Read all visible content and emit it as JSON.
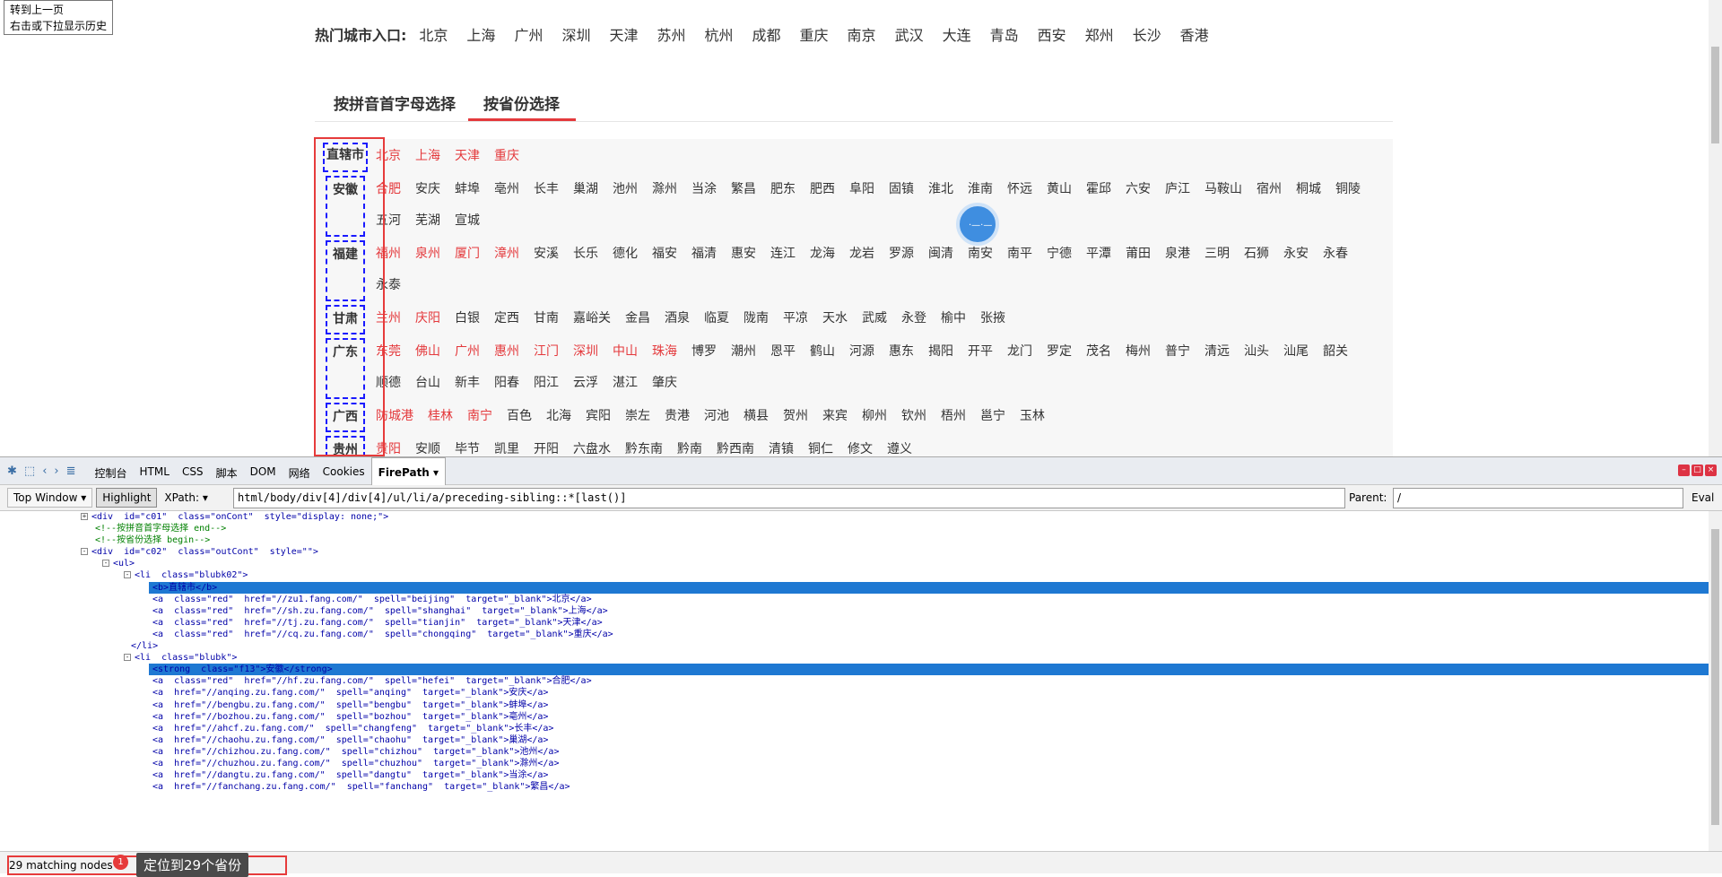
{
  "tooltip": {
    "line1": "转到上一页",
    "line2": "右击或下拉显示历史"
  },
  "hot": {
    "label": "热门城市入口:",
    "cities": [
      "北京",
      "上海",
      "广州",
      "深圳",
      "天津",
      "苏州",
      "杭州",
      "成都",
      "重庆",
      "南京",
      "武汉",
      "大连",
      "青岛",
      "西安",
      "郑州",
      "长沙",
      "香港"
    ]
  },
  "tabs": {
    "pinyin": "按拼音首字母选择",
    "province": "按省份选择"
  },
  "provinces": [
    {
      "name": "直辖市",
      "red": [
        "北京",
        "上海",
        "天津",
        "重庆"
      ],
      "cities": []
    },
    {
      "name": "安徽",
      "red": [
        "合肥"
      ],
      "cities": [
        "安庆",
        "蚌埠",
        "亳州",
        "长丰",
        "巢湖",
        "池州",
        "滁州",
        "当涂",
        "繁昌",
        "肥东",
        "肥西",
        "阜阳",
        "固镇",
        "淮北",
        "淮南",
        "怀远",
        "黄山",
        "霍邱",
        "六安",
        "庐江",
        "马鞍山",
        "宿州",
        "桐城",
        "铜陵",
        "五河",
        "芜湖",
        "宣城"
      ]
    },
    {
      "name": "福建",
      "red": [
        "福州",
        "泉州",
        "厦门",
        "漳州"
      ],
      "cities": [
        "安溪",
        "长乐",
        "德化",
        "福安",
        "福清",
        "惠安",
        "连江",
        "龙海",
        "龙岩",
        "罗源",
        "闽清",
        "南安",
        "南平",
        "宁德",
        "平潭",
        "莆田",
        "泉港",
        "三明",
        "石狮",
        "永安",
        "永春",
        "永泰"
      ]
    },
    {
      "name": "甘肃",
      "red": [
        "兰州",
        "庆阳"
      ],
      "cities": [
        "白银",
        "定西",
        "甘南",
        "嘉峪关",
        "金昌",
        "酒泉",
        "临夏",
        "陇南",
        "平凉",
        "天水",
        "武威",
        "永登",
        "榆中",
        "张掖"
      ]
    },
    {
      "name": "广东",
      "red": [
        "东莞",
        "佛山",
        "广州",
        "惠州",
        "江门",
        "深圳",
        "中山",
        "珠海"
      ],
      "cities": [
        "博罗",
        "潮州",
        "恩平",
        "鹤山",
        "河源",
        "惠东",
        "揭阳",
        "开平",
        "龙门",
        "罗定",
        "茂名",
        "梅州",
        "普宁",
        "清远",
        "汕头",
        "汕尾",
        "韶关",
        "顺德",
        "台山",
        "新丰",
        "阳春",
        "阳江",
        "云浮",
        "湛江",
        "肇庆"
      ]
    },
    {
      "name": "广西",
      "red": [
        "防城港",
        "桂林",
        "南宁"
      ],
      "cities": [
        "百色",
        "北海",
        "宾阳",
        "崇左",
        "贵港",
        "河池",
        "横县",
        "贺州",
        "来宾",
        "柳州",
        "钦州",
        "梧州",
        "邕宁",
        "玉林"
      ]
    },
    {
      "name": "贵州",
      "red": [
        "贵阳"
      ],
      "cities": [
        "安顺",
        "毕节",
        "凯里",
        "开阳",
        "六盘水",
        "黔东南",
        "黔南",
        "黔西南",
        "清镇",
        "铜仁",
        "修文",
        "遵义"
      ]
    }
  ],
  "firebug": {
    "tabs": [
      "控制台",
      "HTML",
      "CSS",
      "脚本",
      "DOM",
      "网络",
      "Cookies",
      "FirePath ▾"
    ],
    "top_window": "Top Window ▾",
    "highlight": "Highlight",
    "xpath_label": "XPath: ▾",
    "xpath_value": "html/body/div[4]/div[4]/ul/li/a/preceding-sibling::*[last()]",
    "parent_label": "Parent:",
    "parent_value": "/",
    "eval": "Eval",
    "code_lines": [
      {
        "indent": 12,
        "tog": "+",
        "text": "<div  id=\"c01\"  class=\"onCont\"  style=\"display: none;\">",
        "kind": "tag"
      },
      {
        "indent": 14,
        "tog": "",
        "text": "<!--按拼音首字母选择 end-->",
        "kind": "comment"
      },
      {
        "indent": 14,
        "tog": "",
        "text": "<!--按省份选择 begin-->",
        "kind": "comment"
      },
      {
        "indent": 12,
        "tog": "-",
        "text": "<div  id=\"c02\"  class=\"outCont\"  style=\"\">",
        "kind": "tag"
      },
      {
        "indent": 15,
        "tog": "-",
        "text": "<ul>",
        "kind": "tag"
      },
      {
        "indent": 18,
        "tog": "-",
        "text": "<li  class=\"blubk02\">",
        "kind": "tag"
      },
      {
        "indent": 22,
        "tog": "",
        "text": "<b>直辖市</b>",
        "kind": "hl"
      },
      {
        "indent": 22,
        "tog": "",
        "text": "<a  class=\"red\"  href=\"//zu1.fang.com/\"  spell=\"beijing\"  target=\"_blank\">北京</a>",
        "kind": "tag"
      },
      {
        "indent": 22,
        "tog": "",
        "text": "<a  class=\"red\"  href=\"//sh.zu.fang.com/\"  spell=\"shanghai\"  target=\"_blank\">上海</a>",
        "kind": "tag"
      },
      {
        "indent": 22,
        "tog": "",
        "text": "<a  class=\"red\"  href=\"//tj.zu.fang.com/\"  spell=\"tianjin\"  target=\"_blank\">天津</a>",
        "kind": "tag"
      },
      {
        "indent": 22,
        "tog": "",
        "text": "<a  class=\"red\"  href=\"//cq.zu.fang.com/\"  spell=\"chongqing\"  target=\"_blank\">重庆</a>",
        "kind": "tag"
      },
      {
        "indent": 19,
        "tog": "",
        "text": "</li>",
        "kind": "tag"
      },
      {
        "indent": 18,
        "tog": "-",
        "text": "<li  class=\"blubk\">",
        "kind": "tag"
      },
      {
        "indent": 22,
        "tog": "",
        "text": "<strong  class=\"f13\">安徽</strong>",
        "kind": "hl"
      },
      {
        "indent": 22,
        "tog": "",
        "text": "<a  class=\"red\"  href=\"//hf.zu.fang.com/\"  spell=\"hefei\"  target=\"_blank\">合肥</a>",
        "kind": "tag"
      },
      {
        "indent": 22,
        "tog": "",
        "text": "<a  href=\"//anqing.zu.fang.com/\"  spell=\"anqing\"  target=\"_blank\">安庆</a>",
        "kind": "tag"
      },
      {
        "indent": 22,
        "tog": "",
        "text": "<a  href=\"//bengbu.zu.fang.com/\"  spell=\"bengbu\"  target=\"_blank\">蚌埠</a>",
        "kind": "tag"
      },
      {
        "indent": 22,
        "tog": "",
        "text": "<a  href=\"//bozhou.zu.fang.com/\"  spell=\"bozhou\"  target=\"_blank\">亳州</a>",
        "kind": "tag"
      },
      {
        "indent": 22,
        "tog": "",
        "text": "<a  href=\"//ahcf.zu.fang.com/\"  spell=\"changfeng\"  target=\"_blank\">长丰</a>",
        "kind": "tag"
      },
      {
        "indent": 22,
        "tog": "",
        "text": "<a  href=\"//chaohu.zu.fang.com/\"  spell=\"chaohu\"  target=\"_blank\">巢湖</a>",
        "kind": "tag"
      },
      {
        "indent": 22,
        "tog": "",
        "text": "<a  href=\"//chizhou.zu.fang.com/\"  spell=\"chizhou\"  target=\"_blank\">池州</a>",
        "kind": "tag"
      },
      {
        "indent": 22,
        "tog": "",
        "text": "<a  href=\"//chuzhou.zu.fang.com/\"  spell=\"chuzhou\"  target=\"_blank\">滁州</a>",
        "kind": "tag"
      },
      {
        "indent": 22,
        "tog": "",
        "text": "<a  href=\"//dangtu.zu.fang.com/\"  spell=\"dangtu\"  target=\"_blank\">当涂</a>",
        "kind": "tag"
      },
      {
        "indent": 22,
        "tog": "",
        "text": "<a  href=\"//fanchang.zu.fang.com/\"  spell=\"fanchang\"  target=\"_blank\">繁昌</a>",
        "kind": "tag"
      }
    ],
    "status_matches": "29 matching nodes",
    "badge": "1",
    "tip": "定位到29个省份"
  }
}
